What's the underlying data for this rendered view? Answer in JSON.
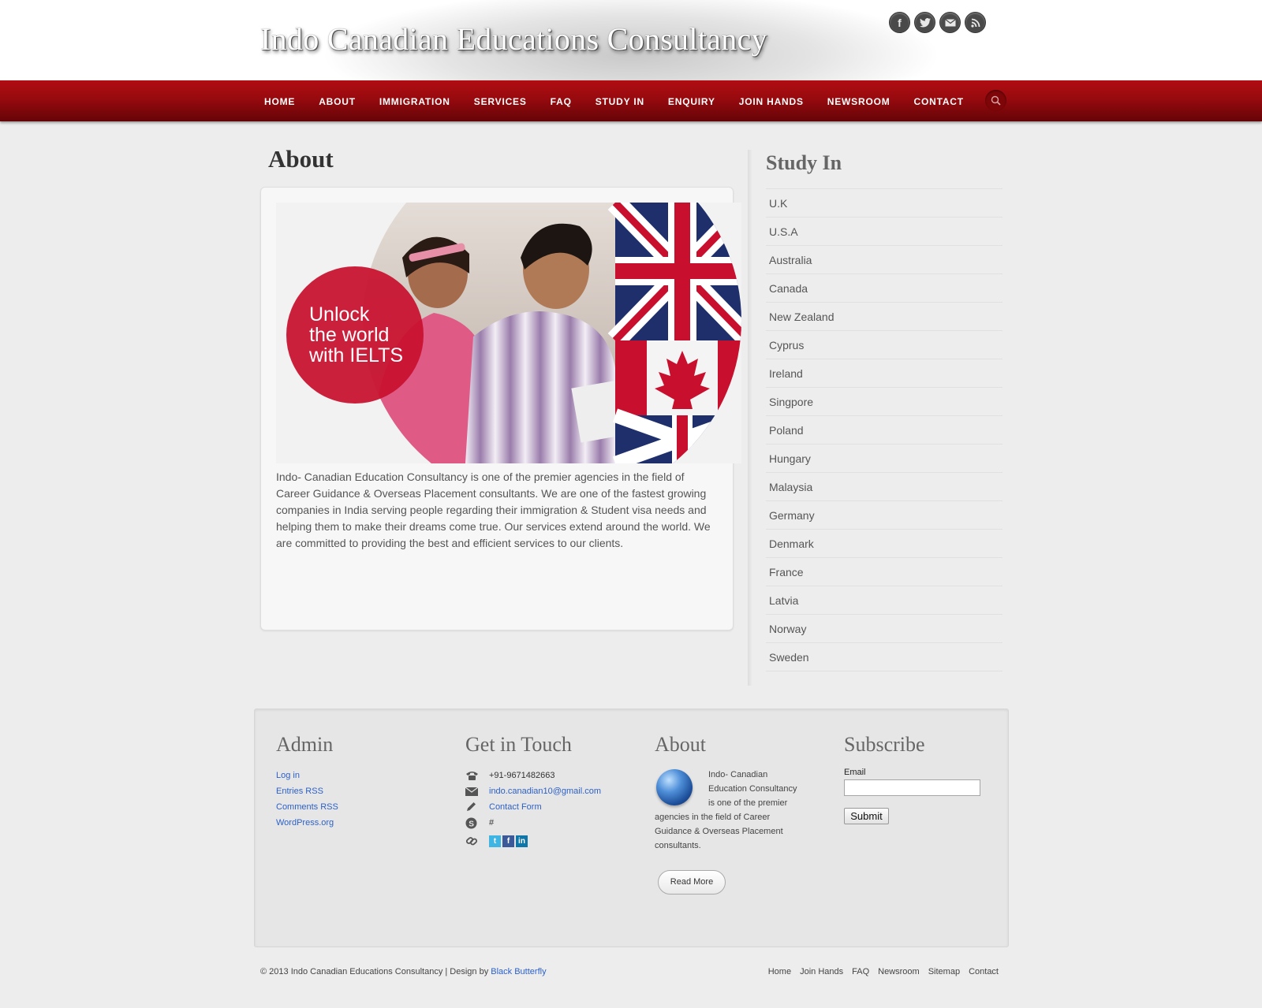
{
  "header": {
    "site_title": "Indo Canadian Educations Consultancy",
    "social_icons": [
      "facebook-icon",
      "twitter-icon",
      "mail-icon",
      "rss-icon"
    ]
  },
  "nav": {
    "items": [
      "HOME",
      "ABOUT",
      "IMMIGRATION",
      "SERVICES",
      "FAQ",
      "STUDY IN",
      "ENQUIRY",
      "JOIN HANDS",
      "NEWSROOM",
      "CONTACT"
    ]
  },
  "main": {
    "title": "About",
    "banner_text": [
      "Unlock",
      "the world",
      "with IELTS"
    ],
    "intro": "Indo- Canadian Education Consultancy is one of the premier agencies in the field of Career Guidance & Overseas Placement consultants. We are one of the fastest growing companies in India serving people regarding their immigration & Student visa needs and helping them to make their dreams come true. Our services extend around the world. We are committed to providing the best and efficient services to our clients."
  },
  "sidebar": {
    "title": "Study In",
    "items": [
      "U.K",
      "U.S.A",
      "Australia",
      "Canada",
      "New Zealand",
      "Cyprus",
      "Ireland",
      "Singpore",
      "Poland",
      "Hungary",
      "Malaysia",
      "Germany",
      "Denmark",
      "France",
      "Latvia",
      "Norway",
      "Sweden"
    ]
  },
  "footer": {
    "admin": {
      "title": "Admin",
      "links": [
        "Log in",
        "Entries RSS",
        "Comments RSS",
        "WordPress.org"
      ]
    },
    "touch": {
      "title": "Get in Touch",
      "phone": "+91-9671482663",
      "email": "indo.canadian10@gmail.com",
      "contact_form": "Contact Form",
      "skype": "#"
    },
    "about": {
      "title": "About",
      "text": "Indo- Canadian Education Consultancy is one of the premier agencies in the field of Career Guidance & Overseas Placement consultants.",
      "read_more": "Read More"
    },
    "subscribe": {
      "title": "Subscribe",
      "email_label": "Email",
      "submit": "Submit"
    }
  },
  "bottom": {
    "copyright_prefix": "© 2013 Indo Canadian Educations Consultancy | Design by ",
    "designer": "Black Butterfly",
    "links": [
      "Home",
      "Join Hands",
      "FAQ",
      "Newsroom",
      "Sitemap",
      "Contact"
    ]
  },
  "colors": {
    "nav_red": "#970a0e",
    "banner_red": "#c8102e",
    "link_blue": "#2c61c9"
  }
}
